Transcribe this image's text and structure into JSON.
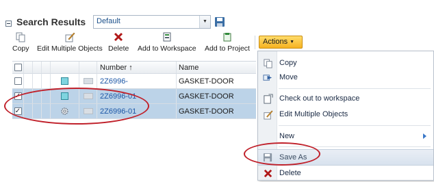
{
  "header": {
    "title": "Search Results",
    "view_value": "Default"
  },
  "toolbar": {
    "copy": "Copy",
    "edit_multiple": "Edit Multiple Objects",
    "delete": "Delete",
    "add_workspace": "Add to Workspace",
    "add_project": "Add to Project",
    "actions": "Actions"
  },
  "table": {
    "columns": {
      "number": "Number",
      "number_sort": "↑",
      "name": "Name"
    },
    "rows": [
      {
        "number": "2Z6996-",
        "name": "GASKET-DOOR",
        "selected": false
      },
      {
        "number": "2Z6996-01",
        "name": "GASKET-DOOR",
        "selected": true
      },
      {
        "number": "2Z6996-01",
        "name": "GASKET-DOOR",
        "selected": true
      }
    ]
  },
  "menu": {
    "copy": "Copy",
    "move": "Move",
    "checkout": "Check out to workspace",
    "edit_multiple": "Edit Multiple Objects",
    "new": "New",
    "save_as": "Save As",
    "delete": "Delete"
  },
  "colors": {
    "accent_actions": "#f6b221",
    "selection": "#bcd3e8",
    "annotation": "#c0202a",
    "link": "#1b56a6"
  }
}
